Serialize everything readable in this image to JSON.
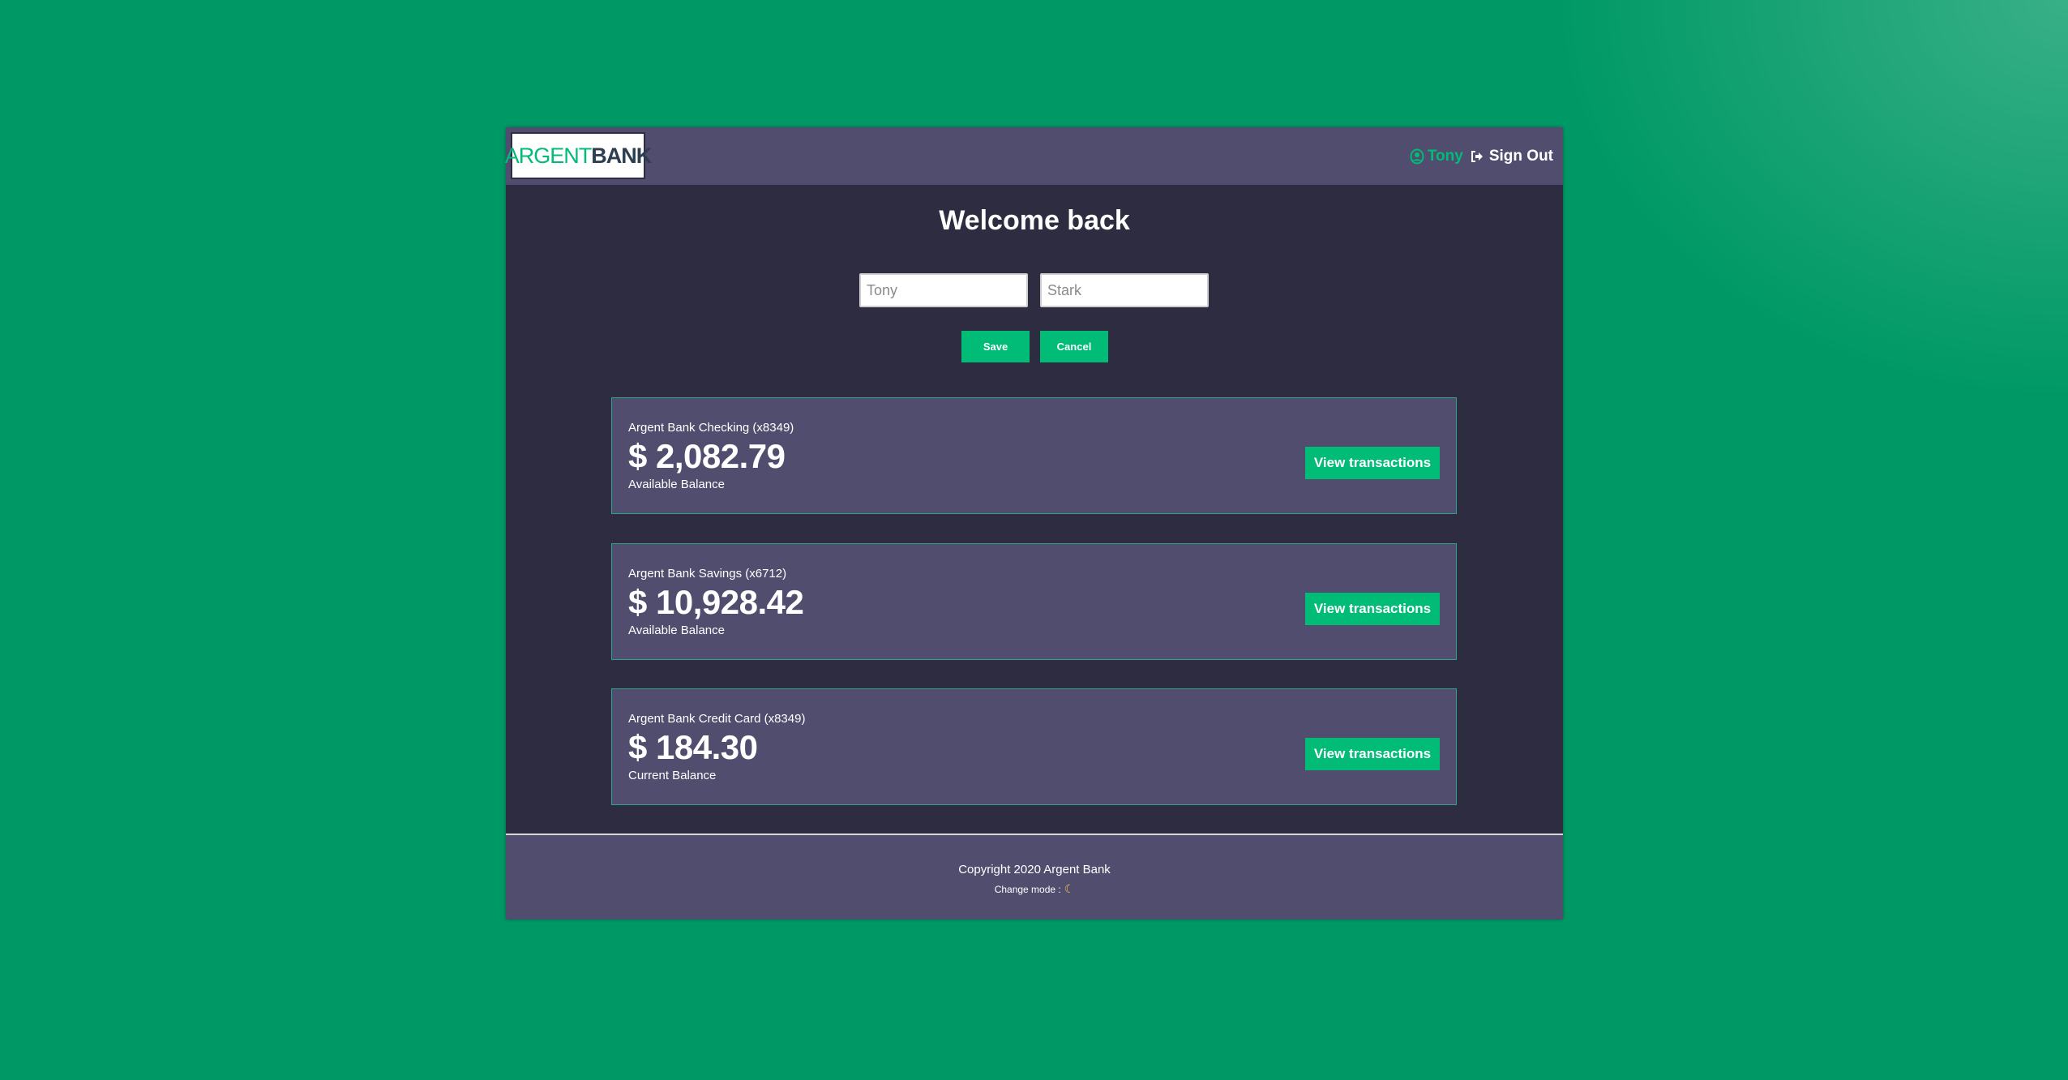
{
  "logo": {
    "part1": "ARGENT",
    "part2": "BANK"
  },
  "nav": {
    "user_name": "Tony",
    "signout_label": "Sign Out",
    "user_icon": "user-circle-icon",
    "signout_icon": "sign-out-icon"
  },
  "title": "Welcome back",
  "edit_form": {
    "first_name_placeholder": "Tony",
    "last_name_placeholder": "Stark",
    "save_label": "Save",
    "cancel_label": "Cancel"
  },
  "accounts": [
    {
      "title": "Argent Bank Checking (x8349)",
      "amount": "$ 2,082.79",
      "description": "Available Balance",
      "button_label": "View transactions"
    },
    {
      "title": "Argent Bank Savings (x6712)",
      "amount": "$ 10,928.42",
      "description": "Available Balance",
      "button_label": "View transactions"
    },
    {
      "title": "Argent Bank Credit Card (x8349)",
      "amount": "$ 184.30",
      "description": "Current Balance",
      "button_label": "View transactions"
    }
  ],
  "footer": {
    "copyright": "Copyright 2020 Argent Bank",
    "mode_label": "Change mode :",
    "mode_icon": "moon-icon"
  },
  "colors": {
    "background": "#009966",
    "accent": "#00bc77",
    "panel": "#514d6e",
    "main": "#2e2c40"
  }
}
